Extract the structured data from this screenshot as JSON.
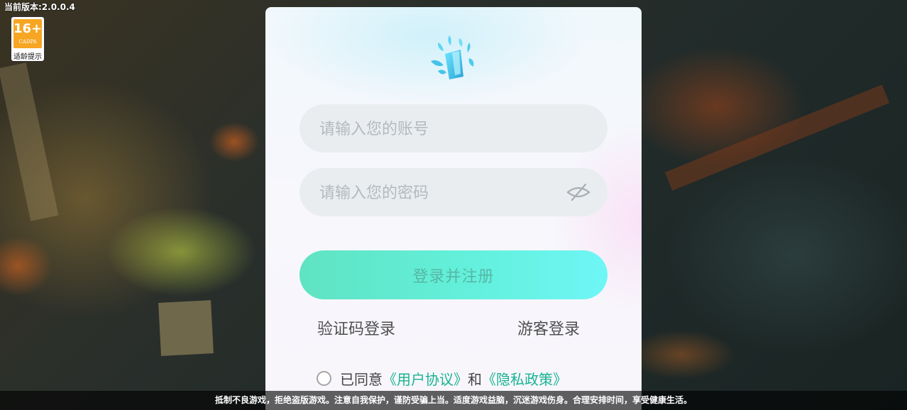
{
  "version_text": "当前版本:2.0.0.4",
  "age_rating": {
    "number": "16+",
    "org": "CADPA",
    "label": "适龄提示",
    "color": "#f6a623"
  },
  "login": {
    "logo_icon": "crystal-leaf-logo-icon",
    "account_placeholder": "请输入您的账号",
    "password_placeholder": "请输入您的密码",
    "password_toggle_icon": "eye-hidden-icon",
    "submit_label": "登录并注册",
    "sms_login_label": "验证码登录",
    "guest_login_label": "游客登录",
    "agreement": {
      "prefix": "已同意",
      "user_agreement": "《用户协议》",
      "conjunction": "和",
      "privacy_policy": "《隐私政策》",
      "link_color": "#18b393",
      "checked": false
    },
    "accent_gradient": [
      "#5fe3c2",
      "#6ef6f6"
    ]
  },
  "footer_notice": "抵制不良游戏，拒绝盗版游戏。注意自我保护，谨防受骗上当。适度游戏益脑，沉迷游戏伤身。合理安排时间，享受健康生活。"
}
